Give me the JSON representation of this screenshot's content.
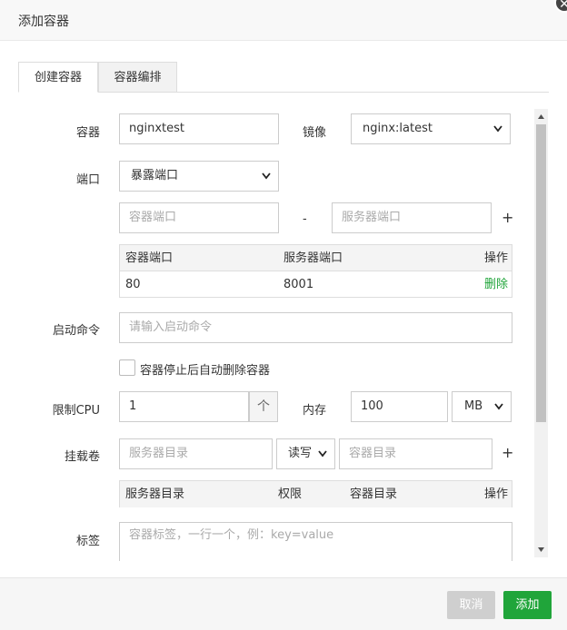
{
  "dialog": {
    "title": "添加容器",
    "close": "✕"
  },
  "tabs": [
    {
      "label": "创建容器",
      "active": true
    },
    {
      "label": "容器编排",
      "active": false
    }
  ],
  "form": {
    "container": {
      "label": "容器",
      "value": "nginxtest"
    },
    "image": {
      "label": "镜像",
      "value": "nginx:latest"
    },
    "port": {
      "label": "端口",
      "mode": "暴露端口",
      "container_port_placeholder": "容器端口",
      "separator": "-",
      "server_port_placeholder": "服务器端口",
      "add": "+",
      "table": {
        "headers": [
          "容器端口",
          "服务器端口",
          "操作"
        ],
        "rows": [
          {
            "container_port": "80",
            "server_port": "8001",
            "action": "删除"
          }
        ]
      }
    },
    "command": {
      "label": "启动命令",
      "placeholder": "请输入启动命令"
    },
    "auto_remove": {
      "label": "容器停止后自动删除容器",
      "checked": false
    },
    "cpu": {
      "label": "限制CPU",
      "value": "1",
      "stepper": "个"
    },
    "memory": {
      "label": "内存",
      "value": "100",
      "unit": "MB"
    },
    "volume": {
      "label": "挂载卷",
      "server_dir_placeholder": "服务器目录",
      "permission": "读写",
      "container_dir_placeholder": "容器目录",
      "add": "+",
      "table": {
        "headers": [
          "服务器目录",
          "权限",
          "容器目录",
          "操作"
        ]
      }
    },
    "labels": {
      "label": "标签",
      "placeholder": "容器标签，一行一个，例：key=value"
    }
  },
  "footer": {
    "cancel": "取消",
    "add": "添加"
  },
  "colors": {
    "accent": "#20a53a",
    "cancel_bg": "#cfcfcf",
    "delete_link": "#20a53a"
  }
}
